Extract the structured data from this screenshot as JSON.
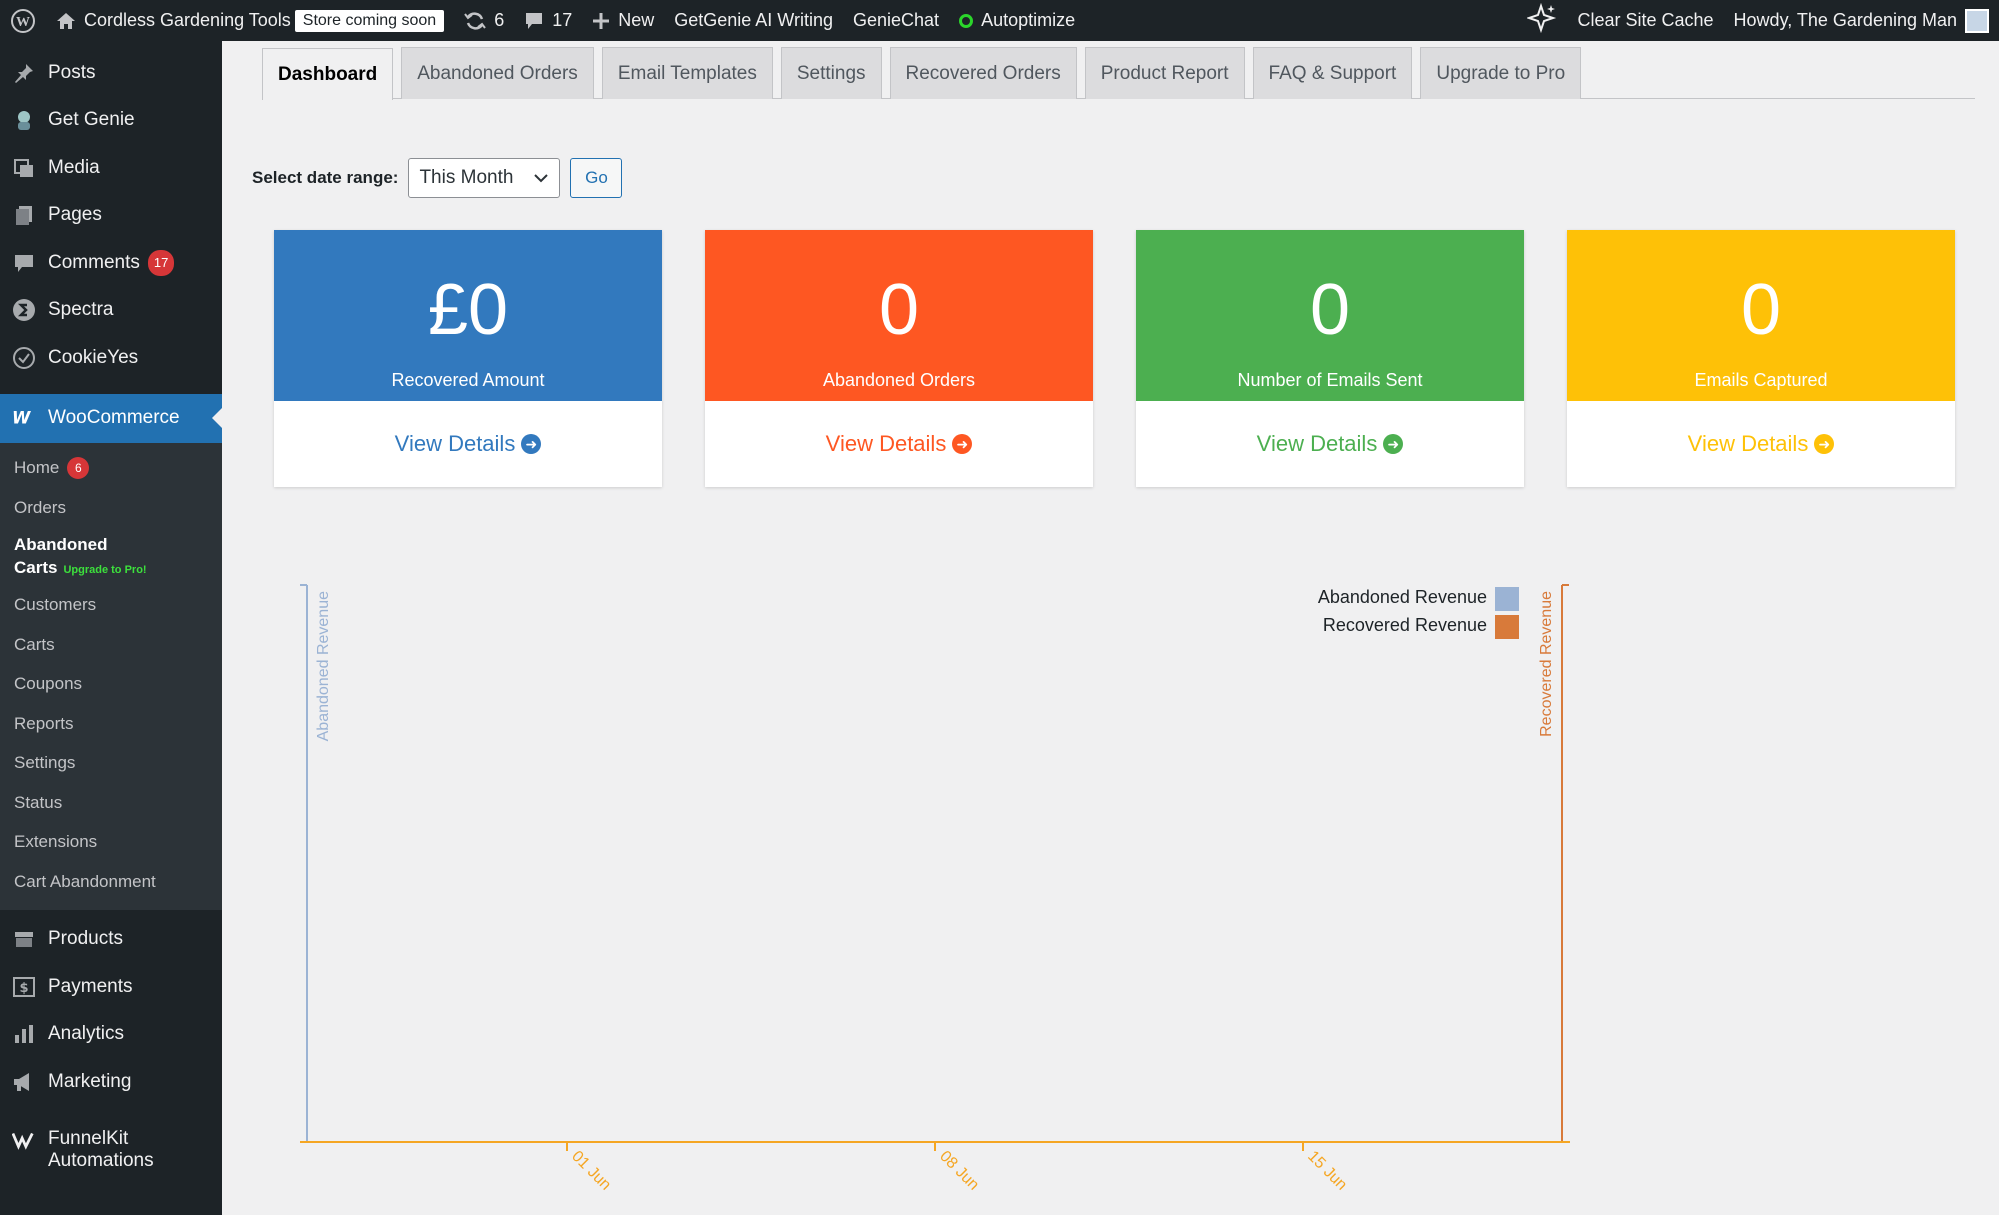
{
  "adminbar": {
    "site_name": "Cordless Gardening Tools",
    "store_badge": "Store coming soon",
    "updates_count": "6",
    "comments_count": "17",
    "new_label": "New",
    "getgenie_label": "GetGenie AI Writing",
    "geniechat_label": "GenieChat",
    "autoptimize_label": "Autoptimize",
    "clear_cache_label": "Clear Site Cache",
    "howdy_label": "Howdy, The Gardening Man"
  },
  "sidebar": {
    "top_items": [
      {
        "label": "Posts",
        "icon": "pin-icon"
      },
      {
        "label": "Get Genie",
        "icon": "genie-icon"
      },
      {
        "label": "Media",
        "icon": "media-icon"
      },
      {
        "label": "Pages",
        "icon": "pages-icon"
      },
      {
        "label": "Comments",
        "icon": "comments-icon",
        "count": "17"
      },
      {
        "label": "Spectra",
        "icon": "spectra-icon"
      },
      {
        "label": "CookieYes",
        "icon": "cookie-icon"
      }
    ],
    "woocommerce_label": "WooCommerce",
    "sub_items": {
      "home": "Home",
      "home_count": "6",
      "orders": "Orders",
      "abandoned_line1": "Abandoned",
      "abandoned_line2": "Carts",
      "upgrade_pro": "Upgrade to Pro!",
      "customers": "Customers",
      "carts": "Carts",
      "coupons": "Coupons",
      "reports": "Reports",
      "settings": "Settings",
      "status": "Status",
      "extensions": "Extensions",
      "cart_abandonment": "Cart Abandonment"
    },
    "bottom_items": [
      {
        "label": "Products",
        "icon": "products-icon"
      },
      {
        "label": "Payments",
        "icon": "payments-icon"
      },
      {
        "label": "Analytics",
        "icon": "analytics-icon"
      },
      {
        "label": "Marketing",
        "icon": "marketing-icon"
      }
    ],
    "funnelkit_line1": "FunnelKit",
    "funnelkit_line2": "Automations"
  },
  "tabs": [
    "Dashboard",
    "Abandoned Orders",
    "Email Templates",
    "Settings",
    "Recovered Orders",
    "Product Report",
    "FAQ & Support",
    "Upgrade to Pro"
  ],
  "date_range": {
    "label": "Select date range:",
    "selected": "This Month",
    "go_label": "Go"
  },
  "cards": [
    {
      "value": "£0",
      "label": "Recovered Amount",
      "link": "View Details",
      "color": "#3279be"
    },
    {
      "value": "0",
      "label": "Abandoned Orders",
      "link": "View Details",
      "color": "#fe5722"
    },
    {
      "value": "0",
      "label": "Number of Emails Sent",
      "link": "View Details",
      "color": "#4caf50"
    },
    {
      "value": "0",
      "label": "Emails Captured",
      "link": "View Details",
      "color": "#fec107"
    }
  ],
  "chart_data": {
    "type": "line",
    "x_ticks": [
      "01 Jun",
      "08 Jun",
      "15 Jun"
    ],
    "y_left_label": "Abandoned Revenue",
    "y_right_label": "Recovered Revenue",
    "series": [
      {
        "name": "Abandoned Revenue",
        "color": "#9bb3d4",
        "values": []
      },
      {
        "name": "Recovered Revenue",
        "color": "#d87a3a",
        "values": []
      }
    ],
    "axis_colors": {
      "left": "#9bb3d4",
      "right": "#d87a3a",
      "x": "#f5a623"
    },
    "grid": false,
    "legend": "top-right"
  }
}
